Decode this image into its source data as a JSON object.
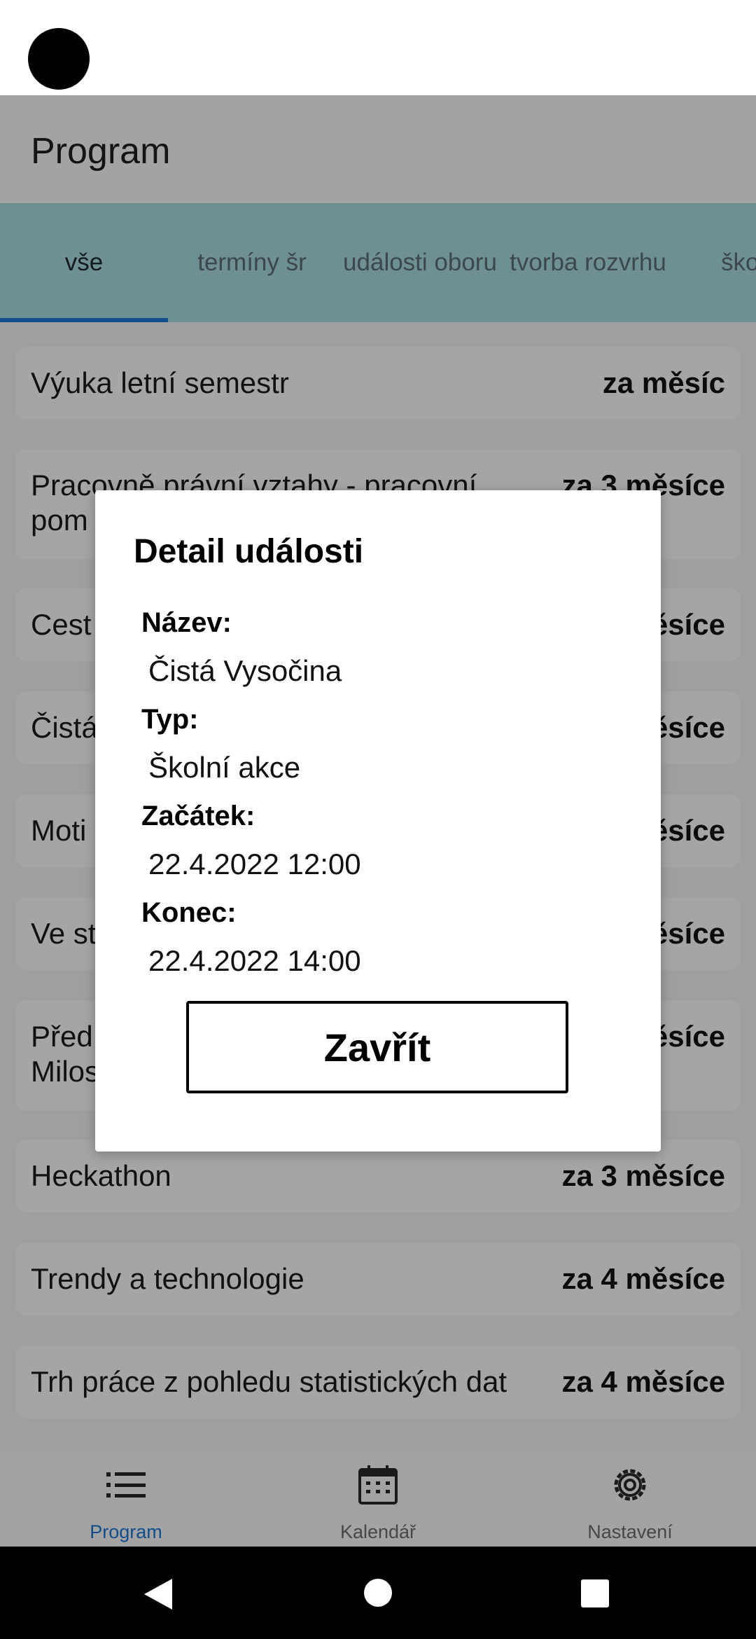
{
  "app": {
    "title": "Program"
  },
  "tabs": [
    {
      "label": "vše",
      "active": true
    },
    {
      "label": "termíny šr",
      "active": false
    },
    {
      "label": "události oboru",
      "active": false
    },
    {
      "label": "tvorba rozvrhu",
      "active": false
    },
    {
      "label": "škol akc",
      "active": false
    }
  ],
  "events": [
    {
      "title": "Výuka letní semestr",
      "when": "za měsíc"
    },
    {
      "title": "Pracovně právní vztahy - pracovní pom",
      "when": "za 3 měsíce"
    },
    {
      "title": "Cest",
      "when": "měsíce"
    },
    {
      "title": "Čistá",
      "when": "měsíce"
    },
    {
      "title": "Moti",
      "when": "měsíce"
    },
    {
      "title": "Ve st",
      "when": "měsíce"
    },
    {
      "title": "Před Milos",
      "when": "měsíce"
    },
    {
      "title": "Heckathon",
      "when": "za 3 měsíce"
    },
    {
      "title": "Trendy a technologie",
      "when": "za 4 měsíce"
    },
    {
      "title": "Trh práce z pohledu statistických dat",
      "when": "za 4 měsíce"
    }
  ],
  "dialog": {
    "title": "Detail události",
    "name_label": "Název:",
    "name_value": "Čistá Vysočina",
    "type_label": "Typ:",
    "type_value": "Školní akce",
    "start_label": "Začátek:",
    "start_value": "22.4.2022 12:00",
    "end_label": "Konec:",
    "end_value": "22.4.2022 14:00",
    "close_label": "Zavřít"
  },
  "bottom_nav": [
    {
      "label": "Program",
      "icon": "list-icon",
      "active": true
    },
    {
      "label": "Kalendář",
      "icon": "calendar-icon",
      "active": false
    },
    {
      "label": "Nastavení",
      "icon": "gear-icon",
      "active": false
    }
  ],
  "colors": {
    "accent": "#1976d2",
    "tab_bar": "#a8dbe0"
  }
}
